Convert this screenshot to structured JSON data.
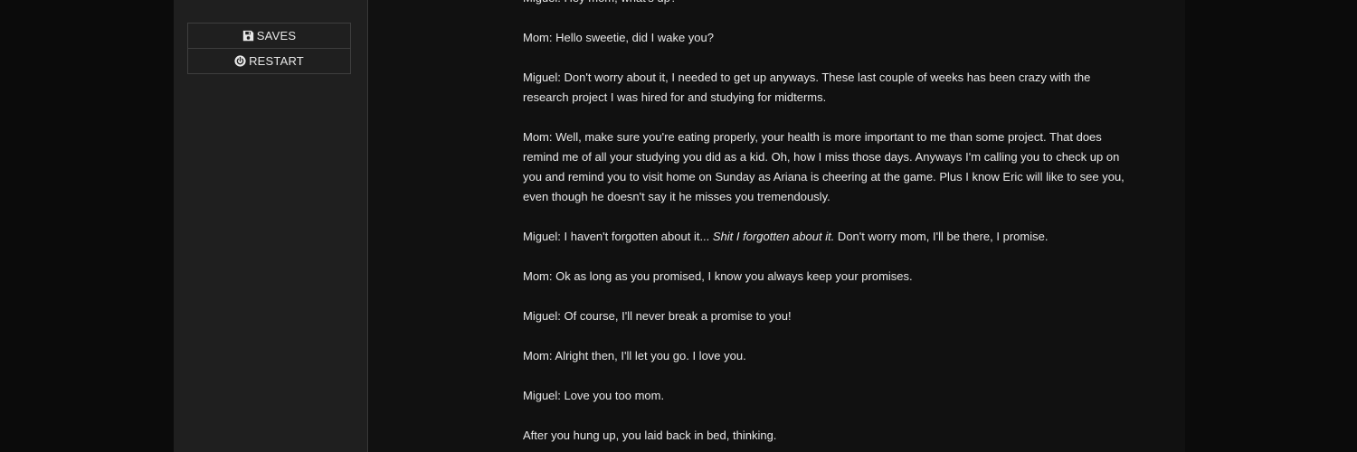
{
  "sidebar": {
    "saves_label": "SAVES",
    "restart_label": "RESTART"
  },
  "story": {
    "p1": "Miguel: Hey mom, what's up?",
    "p2": "Mom: Hello sweetie, did I wake you?",
    "p3": "Miguel: Don't worry about it, I needed to get up anyways. These last couple of weeks has been crazy with the research project I was hired for and studying for midterms.",
    "p4": "Mom: Well, make sure you're eating properly, your health is more important to me than some project. That does remind me of all your studying you did as a kid. Oh, how I miss those days. Anyways I'm calling you to check up on you and remind you to visit home on Sunday as Ariana is cheering at the game. Plus I know Eric will like to see you, even though he doesn't say it he misses you tremendously.",
    "p5_start": "Miguel: I haven't forgotten about it... ",
    "p5_italic": "Shit I forgotten about it.",
    "p5_end": " Don't worry mom, I'll be there, I promise.",
    "p6": "Mom: Ok as long as you promised, I know you always keep your promises.",
    "p7": "Miguel: Of course, I'll never break a promise to you!",
    "p8": "Mom: Alright then, I'll let you go. I love you.",
    "p9": "Miguel: Love you too mom.",
    "p10": "After you hung up, you laid back in bed, thinking."
  }
}
